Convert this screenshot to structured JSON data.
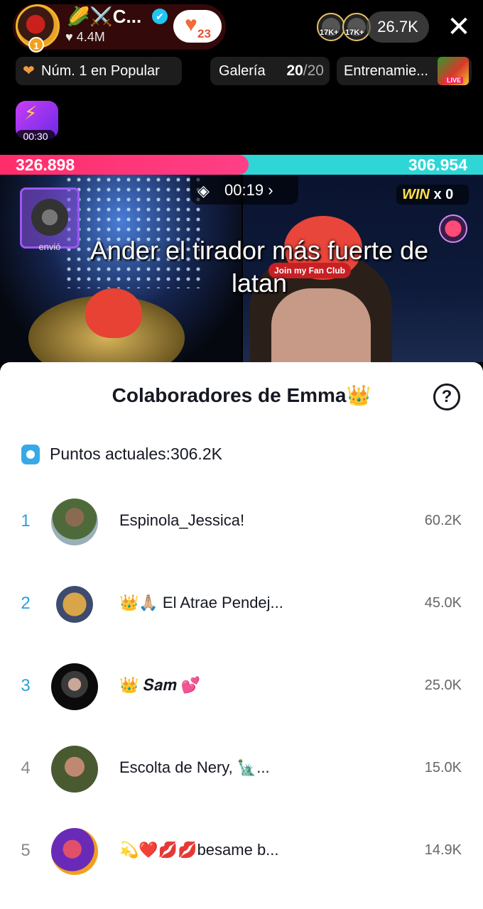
{
  "host": {
    "name": "🌽⚔️C...",
    "likes": "4.4M",
    "level_badge": "1",
    "follow_count": "23",
    "verified_mark": "✔"
  },
  "viewers": {
    "avatar_labels": [
      "17K+",
      "17K+"
    ],
    "count": "26.7K"
  },
  "chips": {
    "rank": "Núm. 1 en Popular",
    "gallery_label": "Galería",
    "gallery_count": "20",
    "gallery_total": "/20",
    "training": "Entrenamie...",
    "training_live": "LIVE"
  },
  "boost": {
    "timer": "00:30"
  },
  "battle": {
    "score_left": "326.898",
    "score_right": "306.954",
    "timer": "00:19",
    "timer_arrow": "›",
    "win_word": "WIN",
    "win_count": "x 0",
    "sender_label": "envió",
    "fan_club": "Join my Fan Club"
  },
  "overlay": {
    "text": "Ander el tirador más fuerte de latan"
  },
  "sheet": {
    "title": "Colaboradores de Emma👑",
    "help": "?",
    "points": "Puntos actuales:306.2K",
    "contributors": [
      {
        "rank": "1",
        "name": "Espinola_Jessica!",
        "score": "60.2K"
      },
      {
        "rank": "2",
        "name": "👑🙏🏼 El Atrae Pendej...",
        "score": "45.0K"
      },
      {
        "rank": "3",
        "name": "👑 𝑺𝒂𝒎 💕",
        "score": "25.0K"
      },
      {
        "rank": "4",
        "name": "Escolta de Nery, 🗽...",
        "score": "15.0K"
      },
      {
        "rank": "5",
        "name": "💫❤️💋💋besame b...",
        "score": "14.9K"
      }
    ]
  },
  "colors": {
    "left_team": "#ff2d6a",
    "right_team": "#2ed6d6",
    "rank_top3": "#2aa1d8"
  }
}
